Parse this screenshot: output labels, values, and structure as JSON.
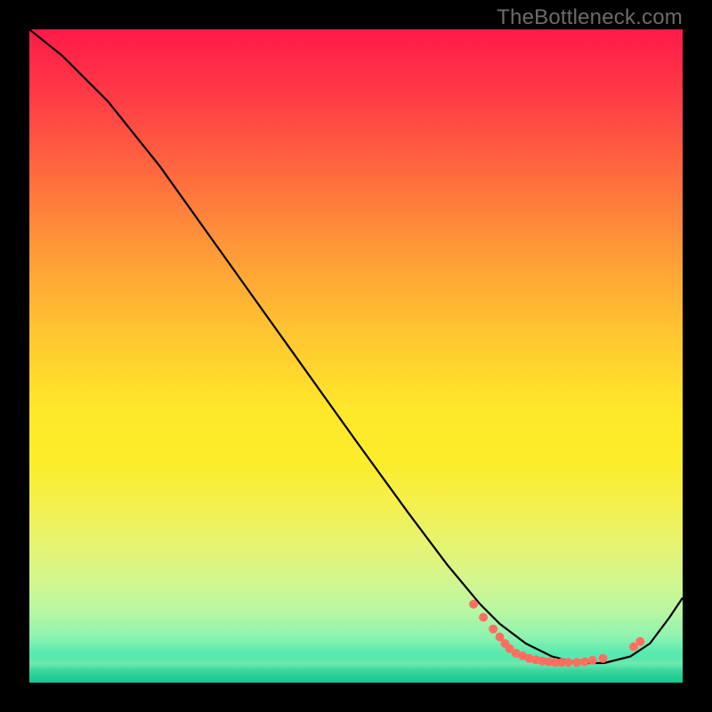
{
  "watermark": {
    "text": "TheBottleneck.com"
  },
  "chart_data": {
    "type": "line",
    "title": "",
    "xlabel": "",
    "ylabel": "",
    "xlim": [
      0,
      1
    ],
    "ylim": [
      0,
      1
    ],
    "legend": false,
    "grid": false,
    "line": {
      "x": [
        0.0,
        0.05,
        0.12,
        0.2,
        0.3,
        0.4,
        0.5,
        0.58,
        0.64,
        0.69,
        0.72,
        0.76,
        0.8,
        0.84,
        0.88,
        0.92,
        0.95,
        0.98,
        1.0
      ],
      "y": [
        1.0,
        0.96,
        0.89,
        0.79,
        0.65,
        0.51,
        0.37,
        0.26,
        0.18,
        0.12,
        0.09,
        0.06,
        0.04,
        0.03,
        0.03,
        0.04,
        0.06,
        0.1,
        0.13
      ],
      "stroke": "#000000",
      "width": 2.2
    },
    "markers": {
      "color": "#ff6f61",
      "radius": 5,
      "points": [
        {
          "x": 0.68,
          "y": 0.12
        },
        {
          "x": 0.695,
          "y": 0.1
        },
        {
          "x": 0.71,
          "y": 0.082
        },
        {
          "x": 0.72,
          "y": 0.07
        },
        {
          "x": 0.728,
          "y": 0.06
        },
        {
          "x": 0.735,
          "y": 0.052
        },
        {
          "x": 0.745,
          "y": 0.045
        },
        {
          "x": 0.755,
          "y": 0.041
        },
        {
          "x": 0.765,
          "y": 0.037
        },
        {
          "x": 0.775,
          "y": 0.035
        },
        {
          "x": 0.785,
          "y": 0.033
        },
        {
          "x": 0.795,
          "y": 0.032
        },
        {
          "x": 0.805,
          "y": 0.031
        },
        {
          "x": 0.815,
          "y": 0.031
        },
        {
          "x": 0.825,
          "y": 0.031
        },
        {
          "x": 0.838,
          "y": 0.031
        },
        {
          "x": 0.85,
          "y": 0.032
        },
        {
          "x": 0.862,
          "y": 0.034
        },
        {
          "x": 0.878,
          "y": 0.037
        },
        {
          "x": 0.925,
          "y": 0.055
        },
        {
          "x": 0.935,
          "y": 0.063
        }
      ]
    },
    "background_gradient": [
      {
        "pos": 0.0,
        "color": "#ff1a48"
      },
      {
        "pos": 0.5,
        "color": "#ffe72a"
      },
      {
        "pos": 1.0,
        "color": "#15c890"
      }
    ]
  }
}
